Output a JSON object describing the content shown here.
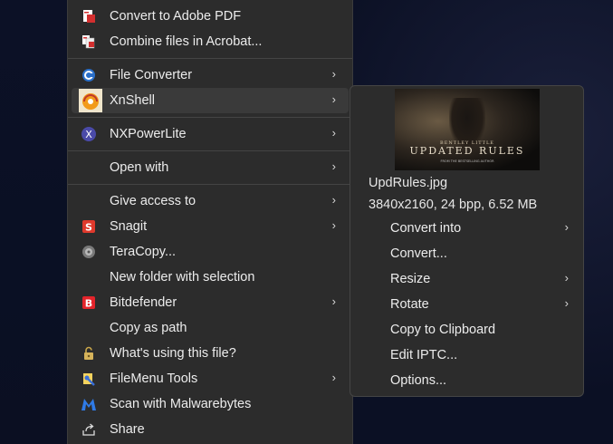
{
  "context_menu": {
    "items": [
      {
        "label": "Convert to Adobe PDF",
        "icon": "adobe-pdf-icon",
        "submenu": false
      },
      {
        "label": "Combine files in Acrobat...",
        "icon": "acrobat-combine-icon",
        "submenu": false
      },
      {
        "label": "File Converter",
        "icon": "file-converter-icon",
        "submenu": true
      },
      {
        "label": "XnShell",
        "icon": "xnshell-icon",
        "submenu": true
      },
      {
        "label": "NXPowerLite",
        "icon": "nxpowerlite-icon",
        "submenu": true
      },
      {
        "label": "Open with",
        "icon": "",
        "submenu": true
      },
      {
        "label": "Give access to",
        "icon": "",
        "submenu": true
      },
      {
        "label": "Snagit",
        "icon": "snagit-icon",
        "submenu": true
      },
      {
        "label": "TeraCopy...",
        "icon": "teracopy-icon",
        "submenu": false
      },
      {
        "label": "New folder with selection",
        "icon": "",
        "submenu": false
      },
      {
        "label": "Bitdefender",
        "icon": "bitdefender-icon",
        "submenu": true
      },
      {
        "label": "Copy as path",
        "icon": "",
        "submenu": false
      },
      {
        "label": "What's using this file?",
        "icon": "lock-icon",
        "submenu": false
      },
      {
        "label": "FileMenu Tools",
        "icon": "filemenu-tools-icon",
        "submenu": true
      },
      {
        "label": "Scan with Malwarebytes",
        "icon": "malwarebytes-icon",
        "submenu": false
      },
      {
        "label": "Share",
        "icon": "share-icon",
        "submenu": false
      }
    ],
    "arrow_glyph": "›"
  },
  "xnshell_submenu": {
    "thumbnail": {
      "line1": "BENTLEY LITTLE",
      "line2": "UPDATED RULES",
      "line3": "FROM THE BESTSELLING AUTHOR"
    },
    "filename": "UpdRules.jpg",
    "fileinfo": "3840x2160, 24 bpp, 6.52 MB",
    "items": [
      {
        "label": "Convert into",
        "submenu": true
      },
      {
        "label": "Convert...",
        "submenu": false
      },
      {
        "label": "Resize",
        "submenu": true
      },
      {
        "label": "Rotate",
        "submenu": true
      },
      {
        "label": "Copy to Clipboard",
        "submenu": false
      },
      {
        "label": "Edit IPTC...",
        "submenu": false
      },
      {
        "label": "Options...",
        "submenu": false
      }
    ]
  },
  "colors": {
    "menu_bg": "#2c2c2c",
    "hover_bg": "#3a3a3a",
    "text": "#ececec",
    "desktop_bg": "#0b1024"
  }
}
